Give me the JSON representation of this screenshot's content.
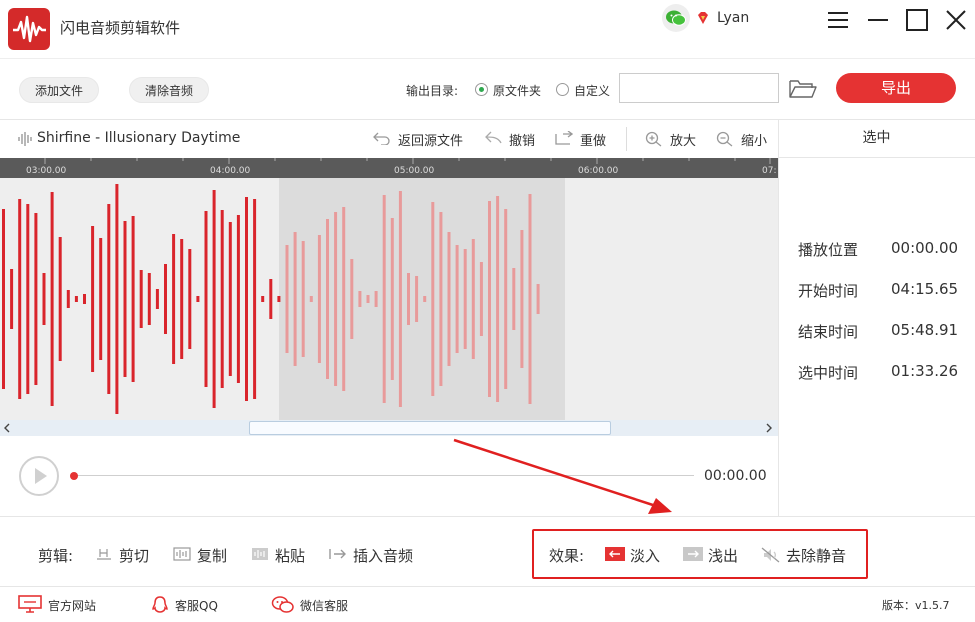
{
  "app": {
    "title": "闪电音频剪辑软件",
    "user_name": "Lyan"
  },
  "toolbar": {
    "add_file": "添加文件",
    "clear_audio": "清除音频",
    "output_label": "输出目录:",
    "option_original": "原文件夹",
    "option_custom": "自定义",
    "path_value": "",
    "export": "导出"
  },
  "track": {
    "name": "Shirfine - Illusionary Daytime",
    "tools": {
      "revert": "返回源文件",
      "undo": "撤销",
      "redo": "重做",
      "zoom_in": "放大",
      "zoom_out": "缩小"
    }
  },
  "timeline": {
    "ticks": [
      "03:00.00",
      "04:00.00",
      "05:00.00",
      "06:00.00",
      "07:"
    ]
  },
  "selection_panel": {
    "title": "选中",
    "play_position_label": "播放位置",
    "play_position": "00:00.00",
    "start_label": "开始时间",
    "start": "04:15.65",
    "end_label": "结束时间",
    "end": "05:48.91",
    "duration_label": "选中时间",
    "duration": "01:33.26"
  },
  "player": {
    "time": "00:00.00",
    "progress": 0
  },
  "edit": {
    "label": "剪辑:",
    "cut": "剪切",
    "copy": "复制",
    "paste": "粘贴",
    "insert": "插入音频"
  },
  "effects": {
    "label": "效果:",
    "fade_in": "淡入",
    "fade_out": "浅出",
    "remove_silence": "去除静音"
  },
  "footer": {
    "website": "官方网站",
    "qq": "客服QQ",
    "wechat": "微信客服",
    "version": "版本：v1.5.7"
  },
  "colors": {
    "accent": "#e53333",
    "wave": "#d9242b",
    "wave_selected": "#e89a9a"
  }
}
